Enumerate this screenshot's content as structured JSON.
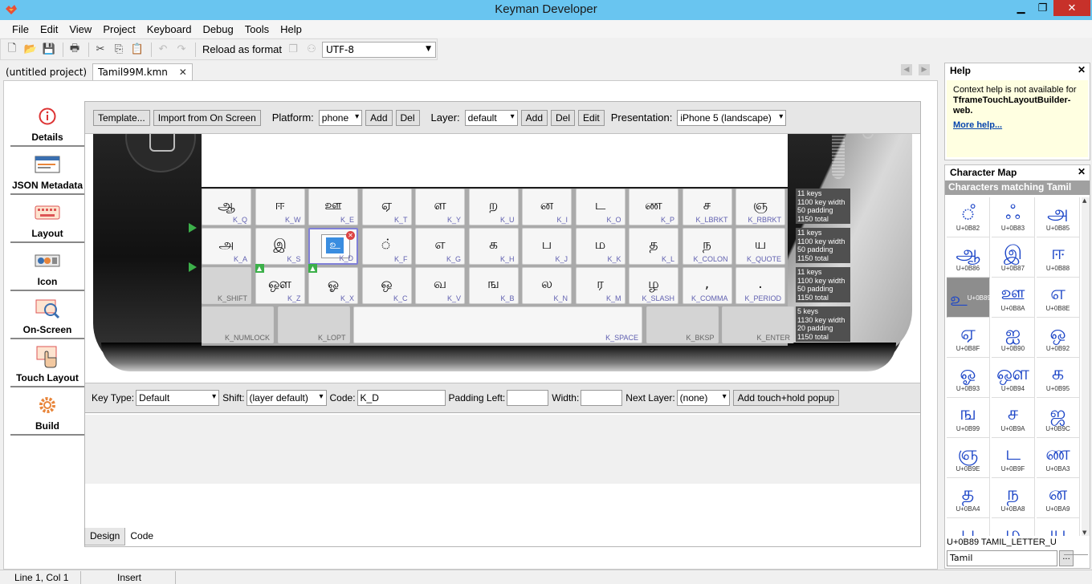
{
  "window": {
    "title": "Keyman Developer",
    "min": "▁",
    "max": "❐",
    "close": "✕"
  },
  "menu": [
    "File",
    "Edit",
    "View",
    "Project",
    "Keyboard",
    "Debug",
    "Tools",
    "Help"
  ],
  "toolbar": {
    "reload_label": "Reload as format",
    "encoding": "UTF-8"
  },
  "doc_tabs": [
    {
      "label": "(untitled project)"
    },
    {
      "label": "Tamil99M.kmn",
      "close": "✕"
    }
  ],
  "nav": [
    "Details",
    "JSON Metadata",
    "Layout",
    "Icon",
    "On-Screen",
    "Touch Layout",
    "Build"
  ],
  "editor_toolbar": {
    "template_btn": "Template...",
    "import_btn": "Import from On Screen",
    "platform_label": "Platform:",
    "platform_value": "phone",
    "add_btn": "Add",
    "del_btn": "Del",
    "layer_label": "Layer:",
    "layer_value": "default",
    "edit_btn": "Edit",
    "presentation_label": "Presentation:",
    "presentation_value": "iPhone 5 (landscape)"
  },
  "keyboard": {
    "rows": [
      [
        {
          "cap": "ஆ",
          "code": "K_Q"
        },
        {
          "cap": "ஈ",
          "code": "K_W"
        },
        {
          "cap": "ஊ",
          "code": "K_E"
        },
        {
          "cap": "ஏ",
          "code": "K_T"
        },
        {
          "cap": "ள",
          "code": "K_Y"
        },
        {
          "cap": "ற",
          "code": "K_U"
        },
        {
          "cap": "ன",
          "code": "K_I"
        },
        {
          "cap": "ட",
          "code": "K_O"
        },
        {
          "cap": "ண",
          "code": "K_P"
        },
        {
          "cap": "ச",
          "code": "K_LBRKT"
        },
        {
          "cap": "ஞ",
          "code": "K_RBRKT"
        }
      ],
      [
        {
          "cap": "அ",
          "code": "K_A"
        },
        {
          "cap": "இ",
          "code": "K_S"
        },
        {
          "cap": "உ",
          "code": "K_D"
        },
        {
          "cap": "்",
          "code": "K_F"
        },
        {
          "cap": "எ",
          "code": "K_G"
        },
        {
          "cap": "க",
          "code": "K_H"
        },
        {
          "cap": "ப",
          "code": "K_J"
        },
        {
          "cap": "ம",
          "code": "K_K"
        },
        {
          "cap": "த",
          "code": "K_L"
        },
        {
          "cap": "ந",
          "code": "K_COLON"
        },
        {
          "cap": "ய",
          "code": "K_QUOTE"
        }
      ],
      [
        {
          "cap": "",
          "code": "K_SHIFT"
        },
        {
          "cap": "ஔ",
          "code": "K_Z"
        },
        {
          "cap": "ஓ",
          "code": "K_X"
        },
        {
          "cap": "ஒ",
          "code": "K_C"
        },
        {
          "cap": "வ",
          "code": "K_V"
        },
        {
          "cap": "ங",
          "code": "K_B"
        },
        {
          "cap": "ல",
          "code": "K_N"
        },
        {
          "cap": "ர",
          "code": "K_M"
        },
        {
          "cap": "ழ",
          "code": "K_SLASH"
        },
        {
          "cap": ",",
          "code": "K_COMMA"
        },
        {
          "cap": ".",
          "code": "K_PERIOD"
        }
      ],
      [
        {
          "cap": "",
          "code": "K_NUMLOCK"
        },
        {
          "cap": "",
          "code": "K_LOPT"
        },
        {
          "cap": "",
          "code": "K_SPACE"
        },
        {
          "cap": "",
          "code": "K_BKSP"
        },
        {
          "cap": "",
          "code": "K_ENTER"
        }
      ]
    ],
    "row_info": [
      [
        "11 keys",
        "1100 key width",
        "50 padding",
        "1150 total"
      ],
      [
        "11 keys",
        "1100 key width",
        "50 padding",
        "1150 total"
      ],
      [
        "11 keys",
        "1100 key width",
        "50 padding",
        "1150 total"
      ],
      [
        "5 keys",
        "1130 key width",
        "20 padding",
        "1150 total"
      ]
    ]
  },
  "props": {
    "key_type_label": "Key Type:",
    "key_type": "Default",
    "shift_label": "Shift:",
    "shift": "(layer default)",
    "code_label": "Code:",
    "code": "K_D",
    "padding_label": "Padding Left:",
    "padding": "",
    "width_label": "Width:",
    "width": "",
    "next_layer_label": "Next Layer:",
    "next_layer": "(none)",
    "add_popup_btn": "Add touch+hold popup"
  },
  "bottom_tabs": [
    "Design",
    "Code"
  ],
  "help": {
    "title": "Help",
    "text1": "Context help is not available for",
    "text2": "TframeTouchLayoutBuilder-web.",
    "link": "More help..."
  },
  "charmap": {
    "title": "Character Map",
    "header": "Characters matching Tamil",
    "cells": [
      {
        "g": "ஂ",
        "u": "U+0B82"
      },
      {
        "g": "ஃ",
        "u": "U+0B83"
      },
      {
        "g": "அ",
        "u": "U+0B85"
      },
      {
        "g": "ஆ",
        "u": "U+0B86"
      },
      {
        "g": "இ",
        "u": "U+0B87"
      },
      {
        "g": "ஈ",
        "u": "U+0B88"
      },
      {
        "g": "உ",
        "u": "U+0B89"
      },
      {
        "g": "ஊ",
        "u": "U+0B8A"
      },
      {
        "g": "எ",
        "u": "U+0B8E"
      },
      {
        "g": "ஏ",
        "u": "U+0B8F"
      },
      {
        "g": "ஐ",
        "u": "U+0B90"
      },
      {
        "g": "ஒ",
        "u": "U+0B92"
      },
      {
        "g": "ஓ",
        "u": "U+0B93"
      },
      {
        "g": "ஔ",
        "u": "U+0B94"
      },
      {
        "g": "க",
        "u": "U+0B95"
      },
      {
        "g": "ங",
        "u": "U+0B99"
      },
      {
        "g": "ச",
        "u": "U+0B9A"
      },
      {
        "g": "ஜ",
        "u": "U+0B9C"
      },
      {
        "g": "ஞ",
        "u": "U+0B9E"
      },
      {
        "g": "ட",
        "u": "U+0B9F"
      },
      {
        "g": "ண",
        "u": "U+0BA3"
      },
      {
        "g": "த",
        "u": "U+0BA4"
      },
      {
        "g": "ந",
        "u": "U+0BA8"
      },
      {
        "g": "ன",
        "u": "U+0BA9"
      },
      {
        "g": "ப",
        "u": ""
      },
      {
        "g": "ம",
        "u": ""
      },
      {
        "g": "ய",
        "u": ""
      }
    ],
    "status": "U+0B89 TAMIL_LETTER_U",
    "filter": "Tamil",
    "filter_btn": "..."
  },
  "statusbar": {
    "position": "Line 1, Col 1",
    "mode": "Insert"
  }
}
